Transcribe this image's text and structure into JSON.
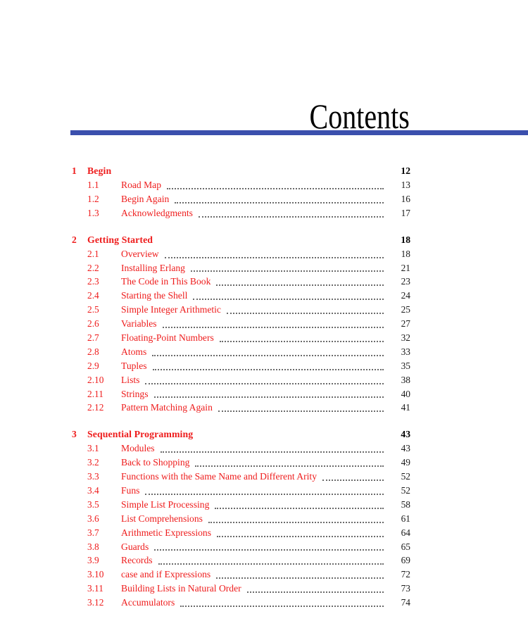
{
  "page": {
    "title": "Contents",
    "rule_color": "#3b4fad",
    "entry_color": "#ee1c1c",
    "pageno_color": "#1a1a1a",
    "leader_color": "#6b6b6b",
    "background": "#ffffff"
  },
  "toc": {
    "entries": [
      {
        "level": "chapter",
        "number": "1",
        "label": "Begin",
        "page": "12"
      },
      {
        "level": "section",
        "number": "1.1",
        "label": "Road Map",
        "page": "13"
      },
      {
        "level": "section",
        "number": "1.2",
        "label": "Begin Again",
        "page": "16"
      },
      {
        "level": "section",
        "number": "1.3",
        "label": "Acknowledgments",
        "page": "17"
      },
      {
        "level": "chapter",
        "number": "2",
        "label": "Getting Started",
        "page": "18"
      },
      {
        "level": "section",
        "number": "2.1",
        "label": "Overview",
        "page": "18"
      },
      {
        "level": "section",
        "number": "2.2",
        "label": "Installing Erlang",
        "page": "21"
      },
      {
        "level": "section",
        "number": "2.3",
        "label": "The Code in This Book",
        "page": "23"
      },
      {
        "level": "section",
        "number": "2.4",
        "label": "Starting the Shell",
        "page": "24"
      },
      {
        "level": "section",
        "number": "2.5",
        "label": "Simple Integer Arithmetic",
        "page": "25"
      },
      {
        "level": "section",
        "number": "2.6",
        "label": "Variables",
        "page": "27"
      },
      {
        "level": "section",
        "number": "2.7",
        "label": "Floating-Point Numbers",
        "page": "32"
      },
      {
        "level": "section",
        "number": "2.8",
        "label": "Atoms",
        "page": "33"
      },
      {
        "level": "section",
        "number": "2.9",
        "label": "Tuples",
        "page": "35"
      },
      {
        "level": "section",
        "number": "2.10",
        "label": "Lists",
        "page": "38"
      },
      {
        "level": "section",
        "number": "2.11",
        "label": "Strings",
        "page": "40"
      },
      {
        "level": "section",
        "number": "2.12",
        "label": "Pattern Matching Again",
        "page": "41"
      },
      {
        "level": "chapter",
        "number": "3",
        "label": "Sequential Programming",
        "page": "43"
      },
      {
        "level": "section",
        "number": "3.1",
        "label": "Modules",
        "page": "43"
      },
      {
        "level": "section",
        "number": "3.2",
        "label": "Back to Shopping",
        "page": "49"
      },
      {
        "level": "section",
        "number": "3.3",
        "label": "Functions with the Same Name and Different Arity",
        "page": "52"
      },
      {
        "level": "section",
        "number": "3.4",
        "label": "Funs",
        "page": "52"
      },
      {
        "level": "section",
        "number": "3.5",
        "label": "Simple List Processing",
        "page": "58"
      },
      {
        "level": "section",
        "number": "3.6",
        "label": "List Comprehensions",
        "page": "61"
      },
      {
        "level": "section",
        "number": "3.7",
        "label": "Arithmetic Expressions",
        "page": "64"
      },
      {
        "level": "section",
        "number": "3.8",
        "label": "Guards",
        "page": "65"
      },
      {
        "level": "section",
        "number": "3.9",
        "label": "Records",
        "page": "69"
      },
      {
        "level": "section",
        "number": "3.10",
        "label": "case and if Expressions",
        "page": "72"
      },
      {
        "level": "section",
        "number": "3.11",
        "label": "Building Lists in Natural Order",
        "page": "73"
      },
      {
        "level": "section",
        "number": "3.12",
        "label": "Accumulators",
        "page": "74"
      }
    ]
  }
}
